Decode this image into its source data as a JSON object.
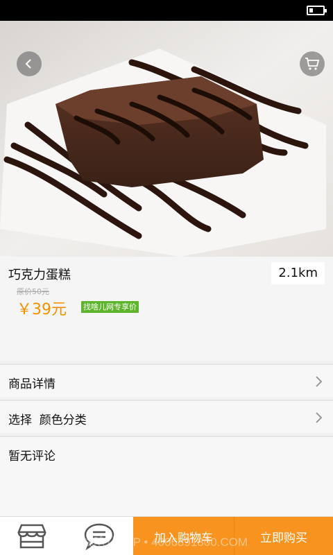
{
  "product": {
    "name": "巧克力蛋糕",
    "distance": "2.1km",
    "original_price": "原价50元",
    "price": "￥39元",
    "badge": "找啥儿网专享价"
  },
  "rows": {
    "details": "商品详情",
    "options": "选择  颜色分类",
    "reviews": "暂无评论"
  },
  "bottom_bar": {
    "add_to_cart": "加入购物车",
    "buy_now": "立即购买",
    "watermark": "找啥儿APP • 4006891800.COM"
  },
  "icons": {
    "back": "chevron-left-icon",
    "cart": "shopping-cart-icon",
    "store": "store-icon",
    "chat": "chat-bubble-icon",
    "chevron": "chevron-right-icon",
    "battery": "battery-icon"
  },
  "colors": {
    "accent": "#f7931e",
    "price": "#f39000",
    "badge": "#5db52c"
  }
}
